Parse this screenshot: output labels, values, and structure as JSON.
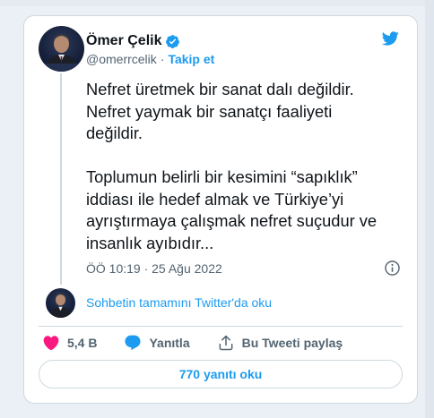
{
  "author": {
    "name": "Ömer Çelik",
    "handle": "@omerrcelik",
    "separator": "·",
    "follow_label": "Takip et",
    "verified_icon": "verified-badge-icon",
    "avatar_icon": "profile-photo"
  },
  "tweet": {
    "paragraph1": [
      "Nefret üretmek bir sanat dalı değildir.",
      "Nefret yaymak bir sanatçı faaliyeti",
      "değildir."
    ],
    "paragraph2": [
      "Toplumun belirli bir kesimini “sapıklık”",
      "iddiası ile hedef almak ve Türkiye’yi",
      "ayrıştırmaya çalışmak nefret suçudur ve",
      "insanlık ayıbıdır..."
    ],
    "timestamp": "ÖÖ 10:19 · 25 Ağu 2022"
  },
  "conversation": {
    "link_label": "Sohbetin tamamını Twitter'da oku"
  },
  "actions": {
    "like_count": "5,4 B",
    "reply_label": "Yanıtla",
    "share_label": "Bu Tweeti paylaş"
  },
  "replies_button": "770 yanıtı oku",
  "colors": {
    "accent": "#1d9bf0",
    "like": "#f91880",
    "text": "#0f1419",
    "muted": "#536471",
    "border": "#cfd9de"
  }
}
